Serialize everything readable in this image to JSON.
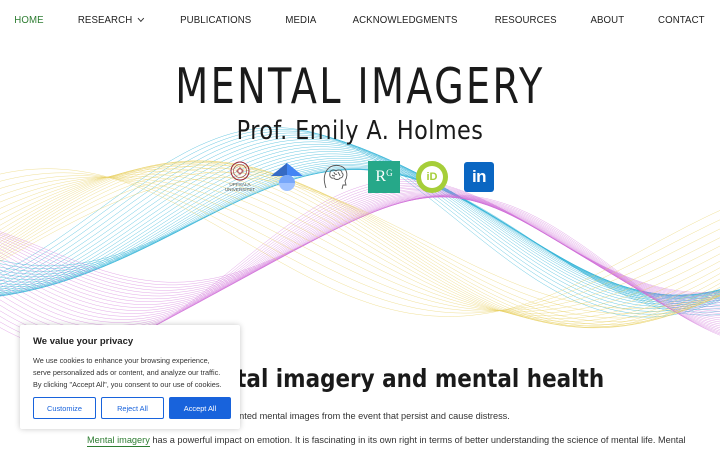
{
  "nav": {
    "items": [
      {
        "label": "HOME",
        "active": true
      },
      {
        "label": "RESEARCH",
        "dropdown": true
      },
      {
        "label": "PUBLICATIONS"
      },
      {
        "label": "MEDIA"
      },
      {
        "label": "ACKNOWLEDGMENTS"
      },
      {
        "label": "RESOURCES"
      },
      {
        "label": "ABOUT"
      },
      {
        "label": "CONTACT"
      }
    ]
  },
  "hero": {
    "title": "MENTAL IMAGERY",
    "subtitle": "Prof. Emily A. Holmes"
  },
  "icons": {
    "uppsala_label": "UPPSALA UNIVERSITET",
    "researchgate_label": "R",
    "researchgate_sup": "G",
    "orcid_label": "iD",
    "linkedin_label": "in"
  },
  "content": {
    "heading_partial": "xplores mental imagery and mental health",
    "para1_partial": "s “flashbacks”) after trauma are unwanted mental images from the event that persist and cause distress.",
    "para2_link": "Mental imagery",
    "para2_rest": " has a powerful impact on emotion. It is fascinating in its own right in terms of better understanding the science of mental life. Mental"
  },
  "cookie": {
    "title": "We value your privacy",
    "text": "We use cookies to enhance your browsing experience, serve personalized ads or content, and analyze our traffic. By clicking \"Accept All\", you consent to our use of cookies.",
    "customize": "Customize",
    "reject": "Reject All",
    "accept": "Accept All"
  },
  "colors": {
    "accent_green": "#2e7d32",
    "cookie_blue": "#1863dc",
    "wave_cyan": "#38b6d8",
    "wave_magenta": "#d070d8",
    "wave_yellow": "#e8d060"
  }
}
